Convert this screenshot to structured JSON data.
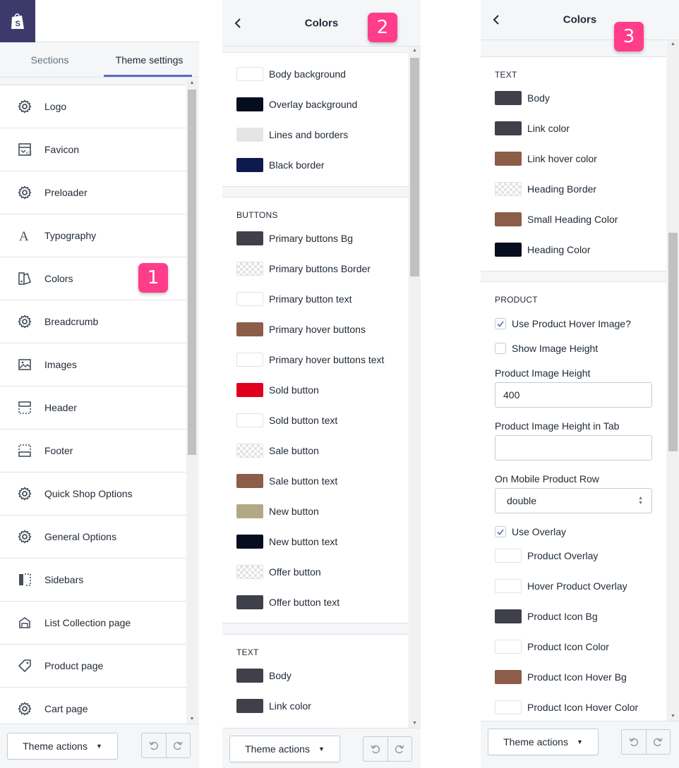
{
  "panel1": {
    "tabs": [
      {
        "label": "Sections",
        "active": false
      },
      {
        "label": "Theme settings",
        "active": true
      }
    ],
    "items": [
      {
        "label": "Logo",
        "icon": "gear-icon"
      },
      {
        "label": "Favicon",
        "icon": "favicon-icon"
      },
      {
        "label": "Preloader",
        "icon": "gear-icon"
      },
      {
        "label": "Typography",
        "icon": "typography-icon"
      },
      {
        "label": "Colors",
        "icon": "colors-icon"
      },
      {
        "label": "Breadcrumb",
        "icon": "gear-icon"
      },
      {
        "label": "Images",
        "icon": "image-icon"
      },
      {
        "label": "Header",
        "icon": "header-icon"
      },
      {
        "label": "Footer",
        "icon": "footer-icon"
      },
      {
        "label": "Quick Shop Options",
        "icon": "gear-icon"
      },
      {
        "label": "General Options",
        "icon": "gear-icon"
      },
      {
        "label": "Sidebars",
        "icon": "sidebar-icon"
      },
      {
        "label": "List Collection page",
        "icon": "collection-icon"
      },
      {
        "label": "Product page",
        "icon": "tag-icon"
      },
      {
        "label": "Cart page",
        "icon": "gear-icon"
      }
    ],
    "badge": "1",
    "theme_actions": "Theme actions"
  },
  "panel2": {
    "title": "Colors",
    "badge": "2",
    "general": [
      {
        "label": "Body background",
        "color": "#ffffff"
      },
      {
        "label": "Overlay background",
        "color": "#060d1e"
      },
      {
        "label": "Lines and borders",
        "color": "#e5e5e5"
      },
      {
        "label": "Black border",
        "color": "#0e1a4e"
      }
    ],
    "buttons_heading": "BUTTONS",
    "buttons": [
      {
        "label": "Primary buttons Bg",
        "color": "#40404b"
      },
      {
        "label": "Primary buttons Border",
        "color": "transparent"
      },
      {
        "label": "Primary button text",
        "color": "#ffffff"
      },
      {
        "label": "Primary hover buttons",
        "color": "#8c5d48"
      },
      {
        "label": "Primary hover buttons text",
        "color": "#ffffff"
      },
      {
        "label": "Sold button",
        "color": "#e0001e"
      },
      {
        "label": "Sold button text",
        "color": "#ffffff"
      },
      {
        "label": "Sale button",
        "color": "transparent"
      },
      {
        "label": "Sale button text",
        "color": "#8c5d48"
      },
      {
        "label": "New button",
        "color": "#b3a886"
      },
      {
        "label": "New button text",
        "color": "#060d1e"
      },
      {
        "label": "Offer button",
        "color": "transparent"
      },
      {
        "label": "Offer button text",
        "color": "#40404b"
      }
    ],
    "text_heading": "TEXT",
    "text": [
      {
        "label": "Body",
        "color": "#40404b"
      },
      {
        "label": "Link color",
        "color": "#40404b"
      }
    ],
    "theme_actions": "Theme actions"
  },
  "panel3": {
    "title": "Colors",
    "badge": "3",
    "text_heading": "TEXT",
    "text": [
      {
        "label": "Body",
        "color": "#40404b"
      },
      {
        "label": "Link color",
        "color": "#40404b"
      },
      {
        "label": "Link hover color",
        "color": "#8c5d48"
      },
      {
        "label": "Heading Border",
        "color": "transparent"
      },
      {
        "label": "Small Heading Color",
        "color": "#8c5d48"
      },
      {
        "label": "Heading Color",
        "color": "#060d1e"
      }
    ],
    "product_heading": "PRODUCT",
    "use_hover_image": {
      "label": "Use Product Hover Image?",
      "checked": true
    },
    "show_image_height": {
      "label": "Show Image Height",
      "checked": false
    },
    "image_height": {
      "label": "Product Image Height",
      "value": "400"
    },
    "image_height_tab": {
      "label": "Product Image Height in Tab",
      "value": ""
    },
    "mobile_row": {
      "label": "On Mobile Product Row",
      "value": "double"
    },
    "use_overlay": {
      "label": "Use Overlay",
      "checked": true
    },
    "product_colors": [
      {
        "label": "Product Overlay",
        "color": "#ffffff"
      },
      {
        "label": "Hover Product Overlay",
        "color": "#ffffff"
      },
      {
        "label": "Product Icon Bg",
        "color": "#40404b"
      },
      {
        "label": "Product Icon Color",
        "color": "#ffffff"
      },
      {
        "label": "Product Icon Hover Bg",
        "color": "#8c5d48"
      },
      {
        "label": "Product Icon Hover Color",
        "color": "#ffffff"
      }
    ],
    "theme_actions": "Theme actions"
  }
}
